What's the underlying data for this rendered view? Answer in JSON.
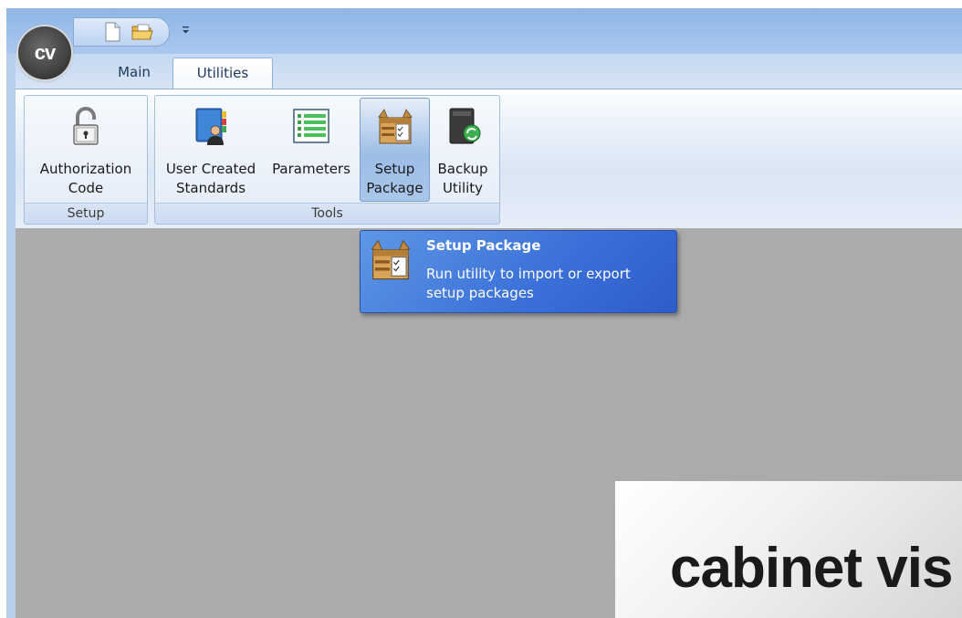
{
  "tabs": [
    {
      "label": "Main",
      "active": false
    },
    {
      "label": "Utilities",
      "active": true
    }
  ],
  "ribbon": {
    "groups": [
      {
        "label": "Setup",
        "buttons": [
          {
            "label_lines": [
              "Authorization",
              "Code"
            ],
            "icon": "padlock-icon"
          }
        ]
      },
      {
        "label": "Tools",
        "buttons": [
          {
            "label_lines": [
              "User Created",
              "Standards"
            ],
            "icon": "user-book-icon"
          },
          {
            "label_lines": [
              "Parameters",
              ""
            ],
            "icon": "list-icon"
          },
          {
            "label_lines": [
              "Setup",
              "Package"
            ],
            "icon": "package-icon",
            "hover": true
          },
          {
            "label_lines": [
              "Backup",
              "Utility"
            ],
            "icon": "backup-icon"
          }
        ]
      }
    ]
  },
  "tooltip": {
    "title": "Setup Package",
    "description": "Run utility to import or export setup packages"
  },
  "app_logo": "cv",
  "splash_text": "cabinet vis",
  "colors": {
    "accent": "#3a6fd8",
    "workspace": "#ababab",
    "ribbon_border": "#8db2e3"
  }
}
